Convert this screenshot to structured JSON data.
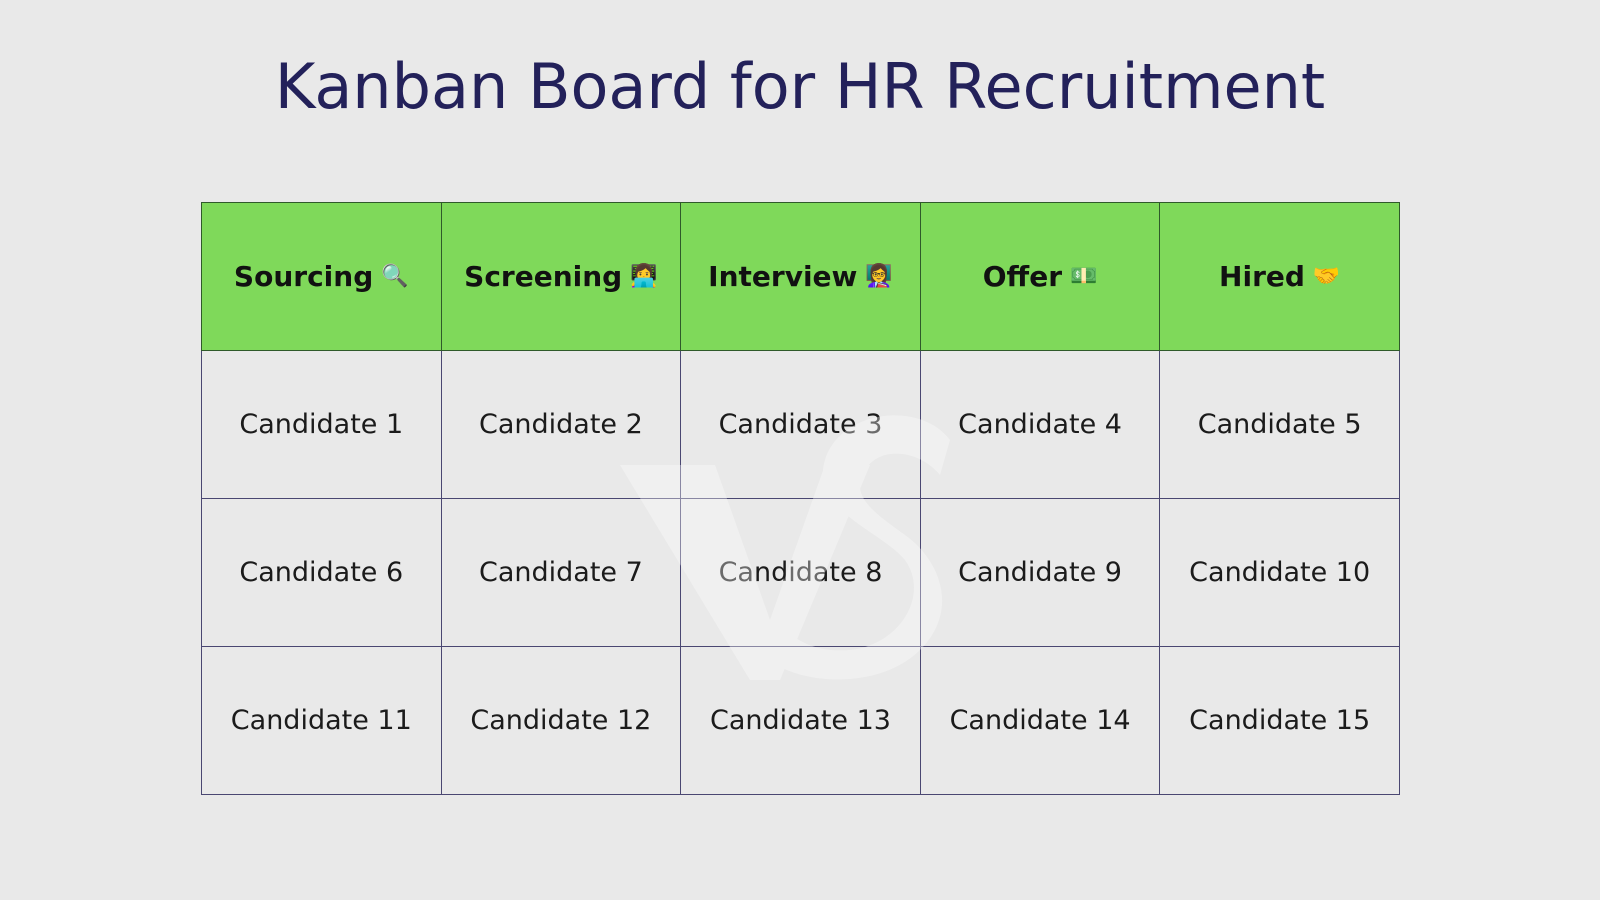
{
  "title": "Kanban Board for HR Recruitment",
  "colors": {
    "title": "#23215a",
    "header_bg": "#7fd95a",
    "background": "#e9e9e9",
    "grid_line": "#4a4772"
  },
  "columns": [
    {
      "label": "Sourcing",
      "icon": "🔍",
      "icon_name": "magnifying-glass-icon"
    },
    {
      "label": "Screening",
      "icon": "👩‍💻",
      "icon_name": "woman-technologist-icon"
    },
    {
      "label": "Interview",
      "icon": "👩‍🏫",
      "icon_name": "woman-teacher-icon"
    },
    {
      "label": "Offer",
      "icon": "💵",
      "icon_name": "dollar-banknote-icon"
    },
    {
      "label": "Hired",
      "icon": "🤝",
      "icon_name": "handshake-icon"
    }
  ],
  "rows": [
    [
      "Candidate 1",
      "Candidate 2",
      "Candidate 3",
      "Candidate 4",
      "Candidate 5"
    ],
    [
      "Candidate 6",
      "Candidate 7",
      "Candidate 8",
      "Candidate 9",
      "Candidate 10"
    ],
    [
      "Candidate 11",
      "Candidate 12",
      "Candidate 13",
      "Candidate 14",
      "Candidate 15"
    ]
  ]
}
